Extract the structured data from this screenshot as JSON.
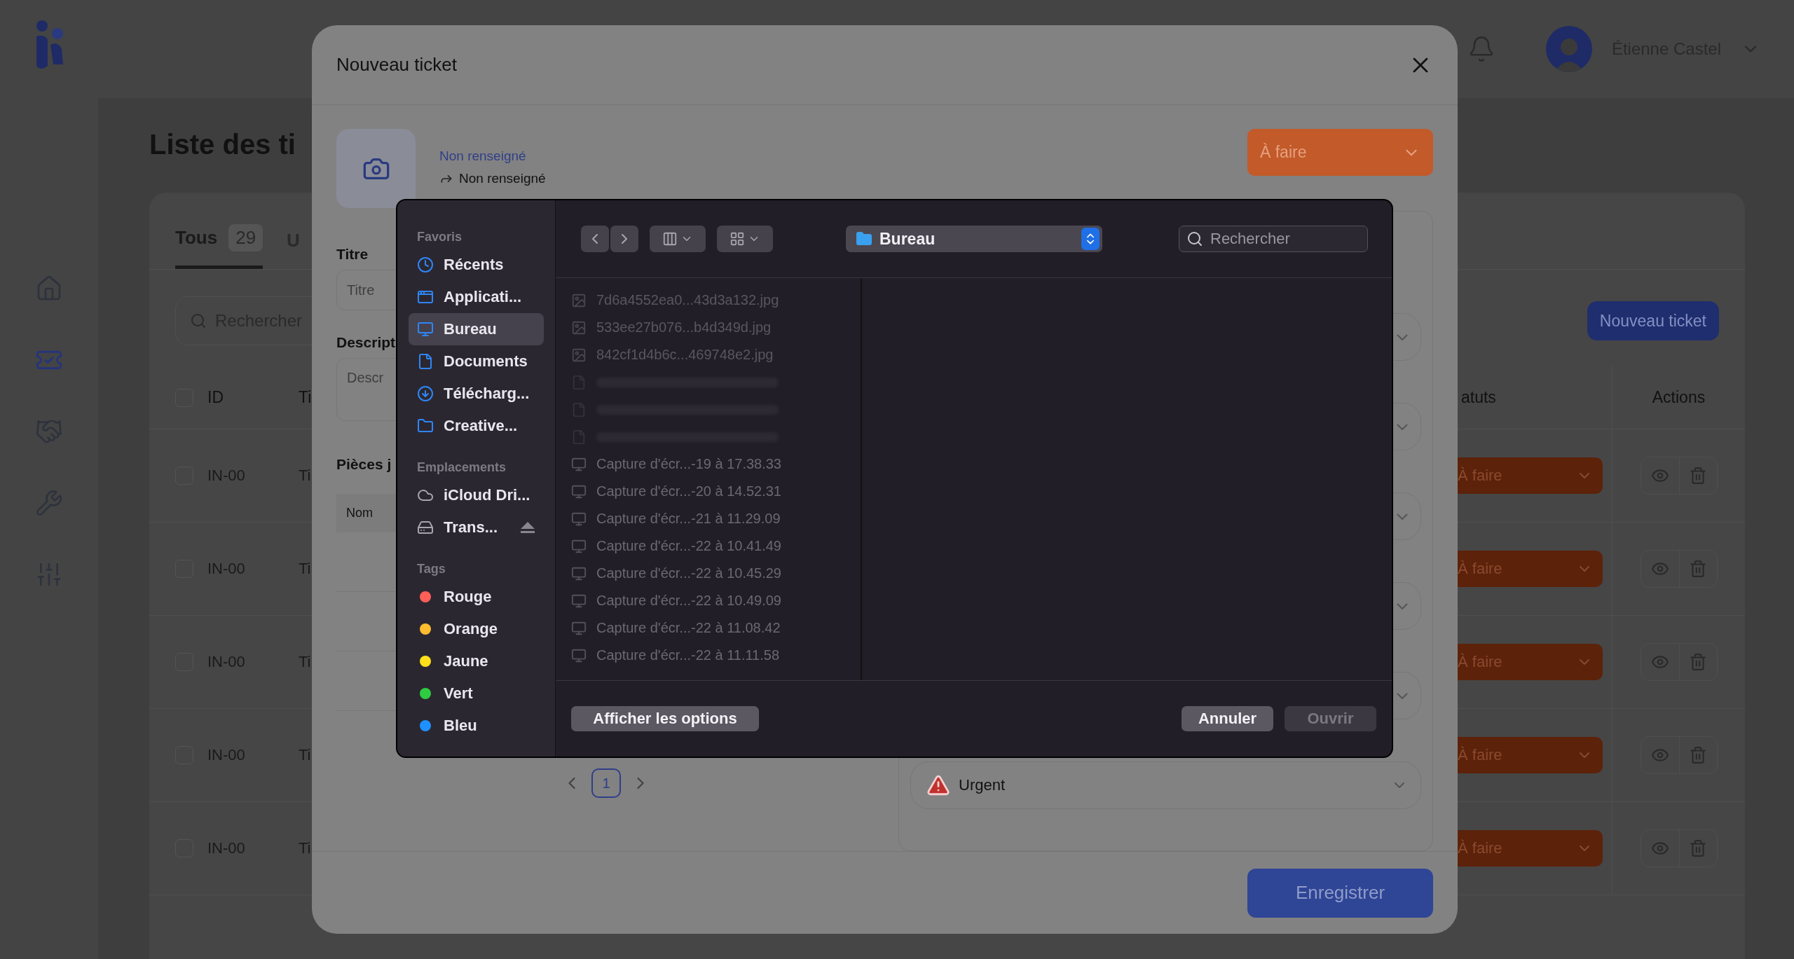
{
  "app": {
    "nav": [
      {
        "kind": "home",
        "selected": false
      },
      {
        "kind": "tickets",
        "selected": true
      },
      {
        "kind": "partners",
        "selected": false
      },
      {
        "kind": "maintenance",
        "selected": false
      },
      {
        "kind": "settings",
        "selected": false
      }
    ],
    "user_name": "Étienne Castel",
    "page_title": "Liste des ti",
    "tabs": [
      {
        "label": "Tous",
        "count": "29",
        "selected": true
      },
      {
        "label": "U",
        "selected": false
      }
    ],
    "search_placeholder": "Rechercher",
    "new_button": "Nouveau ticket",
    "select_all_checked": false,
    "columns": [
      "ID",
      "Ti",
      "atuts",
      "Actions"
    ],
    "rows": [
      {
        "id": "IN-00",
        "title": "Ti",
        "status": "À faire",
        "checked": false
      },
      {
        "id": "IN-00",
        "title": "Ti",
        "status": "À faire",
        "checked": false
      },
      {
        "id": "IN-00",
        "title": "Ti",
        "status": "À faire",
        "checked": false
      },
      {
        "id": "IN-00",
        "title": "Ti",
        "status": "À faire",
        "checked": false
      },
      {
        "id": "IN-00",
        "title": "Ti",
        "status": "À faire",
        "checked": false
      }
    ]
  },
  "modal": {
    "title": "Nouveau ticket",
    "link": "Non renseigné",
    "sub": "Non renseigné",
    "status": "À faire",
    "fields": [
      {
        "label": "Titre",
        "placeholder": "Titre",
        "kind": "input"
      },
      {
        "label": "Descript",
        "placeholder": "Descr",
        "kind": "textarea"
      }
    ],
    "attachments_label": "Pièces j",
    "attachments_column": "Nom",
    "page": "1",
    "priority": "Urgent",
    "save": "Enregistrer"
  },
  "file_dialog": {
    "sidebar": [
      {
        "heading": "Favoris",
        "items": [
          {
            "label": "Récents",
            "kind": "recent",
            "selected": false
          },
          {
            "label": "Applicati...",
            "kind": "apps",
            "selected": false
          },
          {
            "label": "Bureau",
            "kind": "desktop",
            "selected": true
          },
          {
            "label": "Documents",
            "kind": "document",
            "selected": false
          },
          {
            "label": "Télécharg...",
            "kind": "download",
            "selected": false
          },
          {
            "label": "Creative...",
            "kind": "folder",
            "selected": false
          }
        ]
      },
      {
        "heading": "Emplacements",
        "items": [
          {
            "label": "iCloud Dri...",
            "kind": "cloud",
            "selected": false
          },
          {
            "label": "Trans...",
            "kind": "drive",
            "selected": false,
            "eject": true
          }
        ]
      },
      {
        "heading": "Tags",
        "items": [
          {
            "label": "Rouge",
            "kind": "tag",
            "color": "#ff5f57",
            "selected": false
          },
          {
            "label": "Orange",
            "kind": "tag",
            "color": "#febc2e",
            "selected": false
          },
          {
            "label": "Jaune",
            "kind": "tag",
            "color": "#ffe01b",
            "selected": false
          },
          {
            "label": "Vert",
            "kind": "tag",
            "color": "#2ecc40",
            "selected": false
          },
          {
            "label": "Bleu",
            "kind": "tag",
            "color": "#1e90ff",
            "selected": false
          }
        ]
      }
    ],
    "location": "Bureau",
    "search_placeholder": "Rechercher",
    "files": [
      {
        "kind": "image",
        "name": "7d6a4552ea0...43d3a132.jpg"
      },
      {
        "kind": "image",
        "name": "533ee27b076...b4d349d.jpg"
      },
      {
        "kind": "image",
        "name": "842cf1d4b6c...469748e2.jpg"
      },
      {
        "kind": "faint"
      },
      {
        "kind": "faint"
      },
      {
        "kind": "faint"
      },
      {
        "kind": "screenshot",
        "name": "Capture d'écr...-19 à 17.38.33"
      },
      {
        "kind": "screenshot",
        "name": "Capture d'écr...-20 à 14.52.31"
      },
      {
        "kind": "screenshot",
        "name": "Capture d'écr...-21 à 11.29.09"
      },
      {
        "kind": "screenshot",
        "name": "Capture d'écr...-22 à 10.41.49"
      },
      {
        "kind": "screenshot",
        "name": "Capture d'écr...-22 à 10.45.29"
      },
      {
        "kind": "screenshot",
        "name": "Capture d'écr...-22 à 10.49.09"
      },
      {
        "kind": "screenshot",
        "name": "Capture d'écr...-22 à 11.08.42"
      },
      {
        "kind": "screenshot",
        "name": "Capture d'écr...-22 à 11.11.58"
      }
    ],
    "options_button": "Afficher les options",
    "cancel": "Annuler",
    "open": "Ouvrir",
    "open_disabled": true
  }
}
